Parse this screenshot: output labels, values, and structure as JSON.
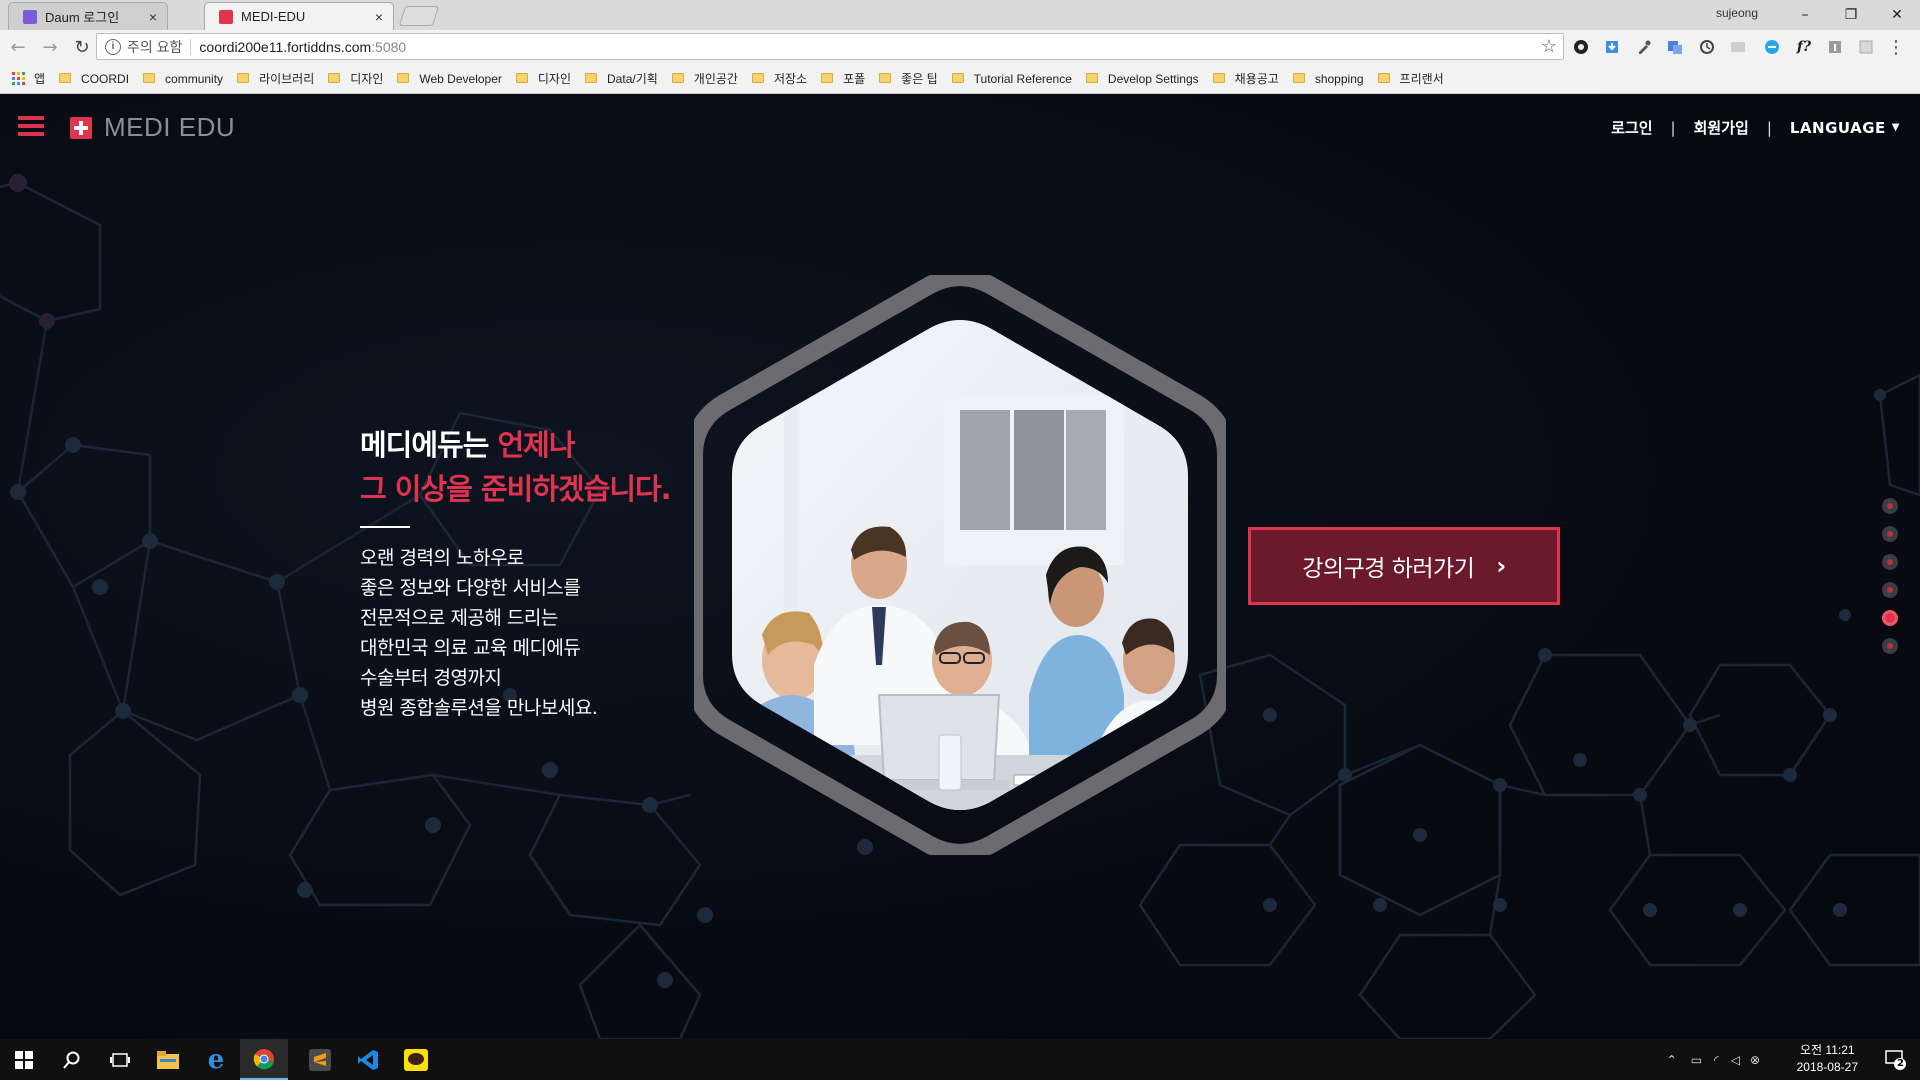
{
  "browser": {
    "tabs": [
      {
        "title": "Daum 로그인",
        "close": "×",
        "favicon_color": "#7b5bd6"
      },
      {
        "title": "MEDI-EDU",
        "close": "×",
        "favicon_color": "#e0334f"
      }
    ],
    "profile_name": "sujeong",
    "window_controls": {
      "minimize": "–",
      "maximize": "❐",
      "close": "✕"
    },
    "nav": {
      "back": "←",
      "forward": "→",
      "reload": "↻"
    },
    "address": {
      "security_label": "주의 요함",
      "host": "coordi200e11.fortiddns.com",
      "port": ":5080",
      "star": "☆"
    },
    "bookmarks": [
      {
        "label": "앱",
        "type": "apps"
      },
      {
        "label": "COORDI",
        "type": "folder"
      },
      {
        "label": "community",
        "type": "folder"
      },
      {
        "label": "라이브러리",
        "type": "folder"
      },
      {
        "label": "디자인",
        "type": "folder"
      },
      {
        "label": "Web Developer",
        "type": "folder"
      },
      {
        "label": "디자인",
        "type": "folder"
      },
      {
        "label": "Data/기획",
        "type": "folder"
      },
      {
        "label": "개인공간",
        "type": "folder"
      },
      {
        "label": "저장소",
        "type": "folder"
      },
      {
        "label": "포폴",
        "type": "folder"
      },
      {
        "label": "좋은 팁",
        "type": "folder"
      },
      {
        "label": "Tutorial Reference",
        "type": "folder"
      },
      {
        "label": "Develop Settings",
        "type": "folder"
      },
      {
        "label": "채용공고",
        "type": "folder"
      },
      {
        "label": "shopping",
        "type": "folder"
      },
      {
        "label": "프리랜서",
        "type": "folder"
      }
    ],
    "extensions": [
      "dark-circle-icon",
      "download-icon",
      "eyedropper-icon",
      "translate-icon",
      "sync-icon",
      "ext-gray-icon",
      "chat-icon",
      "font-icon",
      "info-ext-icon",
      "puzzle-icon",
      "menu-kebab-icon"
    ]
  },
  "site": {
    "logo": "MEDI EDU",
    "nav": {
      "login": "로그인",
      "divider": "|",
      "signup": "회원가입",
      "language": "LANGUAGE",
      "caret": "▼"
    },
    "headline_line1_white": "메디에듀는 ",
    "headline_line1_accent": "언제나",
    "headline_line2": "그 이상을 준비하겠습니다.",
    "body_lines": [
      "오랜 경력의 노하우로",
      "좋은 정보와 다양한 서비스를",
      "전문적으로 제공해 드리는",
      "대한민국 의료 교육 메디에듀",
      "수술부터 경영까지",
      "병원 종합솔루션을 만나보세요."
    ],
    "cta_label": "강의구경 하러가기",
    "cta_chevron": "›",
    "pager": {
      "count": 6,
      "active_index": 4
    },
    "colors": {
      "accent": "#e0334f",
      "background": "#080a12",
      "cta_fill": "#6b1a2a"
    }
  },
  "taskbar": {
    "items": [
      "windows-start-icon",
      "search-icon",
      "task-view-icon",
      "file-explorer-icon",
      "internet-explorer-icon",
      "chrome-icon",
      "sublime-text-icon",
      "vscode-icon",
      "kakaotalk-icon"
    ],
    "active_item": "chrome-icon",
    "clock_time": "오전 11:21",
    "clock_date": "2018-08-27",
    "notification_count": "2"
  }
}
